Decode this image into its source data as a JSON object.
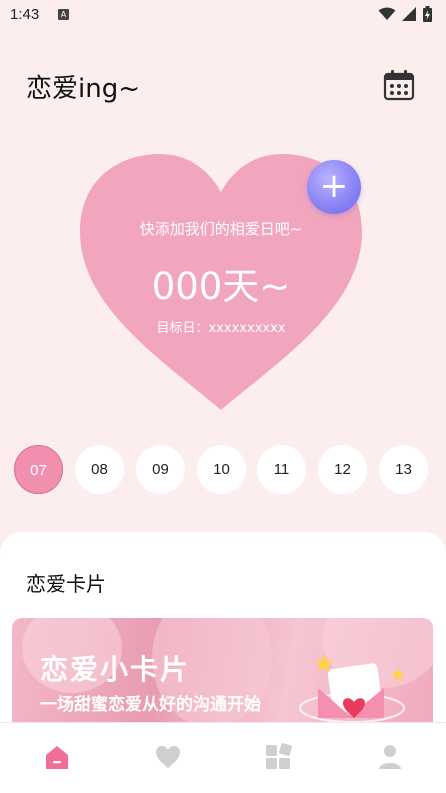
{
  "status": {
    "time": "1:43",
    "a_badge": "A"
  },
  "header": {
    "title": "恋爱ing~"
  },
  "heart": {
    "hint": "快添加我们的相爱日吧~",
    "days": "000天~",
    "target": "目标日：xxxxxxxxxx"
  },
  "days": [
    "07",
    "08",
    "09",
    "10",
    "11",
    "12",
    "13"
  ],
  "cards": {
    "section_title": "恋爱卡片",
    "banner_title": "恋爱小卡片",
    "banner_subtitle": "一场甜蜜恋爱从好的沟通开始"
  },
  "nav": [
    "home-icon",
    "heart-icon",
    "grid-icon",
    "profile-icon"
  ],
  "colors": {
    "background": "#fdeeee",
    "heart": "#f1a6bd",
    "accent": "#f28fae",
    "add_button": "#8c85f5",
    "nav_active": "#f06f97",
    "nav_inactive": "#cfcfcf"
  }
}
